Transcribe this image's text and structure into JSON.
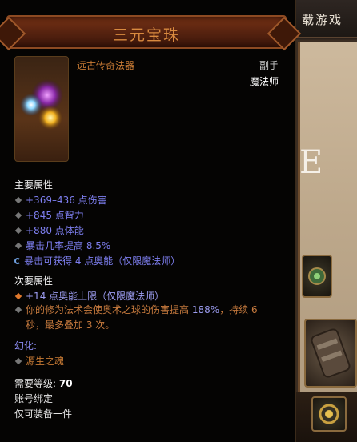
{
  "background": {
    "top_bar_text": "载游戏",
    "large_letter": "E"
  },
  "item": {
    "name": "三元宝珠",
    "type": "远古传奇法器",
    "slot": "副手",
    "class": "魔法师",
    "primary_header": "主要属性",
    "primary_stats": [
      "+369–436 点伤害",
      "+845 点智力",
      "+880 点体能",
      "暴击几率提高 8.5%",
      "暴击可获得 4 点奥能（仅限魔法师）"
    ],
    "secondary_header": "次要属性",
    "secondary_stats": [
      "+14 点奥能上限（仅限魔法师）"
    ],
    "legendary_power_part1": "你的修为法术会使奥术之球的伤害提高 ",
    "legendary_power_value": "188%",
    "legendary_power_part2": "，持续 6",
    "legendary_power_line2": "秒，最多叠加 3 次。",
    "transmog_header": "幻化:",
    "transmog_value": "源生之魂",
    "required_level_label": "需要等级:",
    "required_level_value": "70",
    "account_bound": "账号绑定",
    "unique_equipped": "仅可装备一件"
  },
  "colors": {
    "legendary_orange": "#c77a34",
    "magic_blue": "#7e7ff0",
    "title_text": "#d98a3f"
  }
}
